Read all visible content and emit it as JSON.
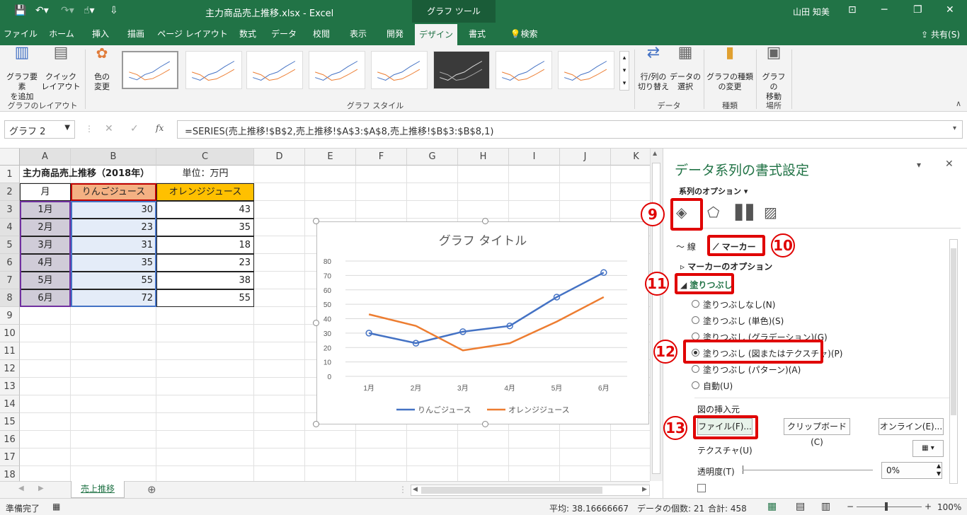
{
  "titlebar": {
    "title": "主力商品売上推移.xlsx  -  Excel",
    "tools_tab": "グラフ ツール",
    "user": "山田 知美"
  },
  "tabs": [
    {
      "label": "ファイル"
    },
    {
      "label": "ホーム"
    },
    {
      "label": "挿入"
    },
    {
      "label": "描画"
    },
    {
      "label": "ページ レイアウト"
    },
    {
      "label": "数式"
    },
    {
      "label": "データ"
    },
    {
      "label": "校閲"
    },
    {
      "label": "表示"
    },
    {
      "label": "開発"
    },
    {
      "label": "デザイン"
    },
    {
      "label": "書式"
    },
    {
      "label": "検索"
    }
  ],
  "share_label": "共有(S)",
  "ribbon": {
    "add_element": "グラフ要素\nを追加",
    "quick_layout": "クイック\nレイアウト",
    "change_color": "色の\n変更",
    "group_layout": "グラフのレイアウト",
    "group_style": "グラフ スタイル",
    "switch_rowcol": "行/列の\n切り替え",
    "select_data": "データの\n選択",
    "group_data": "データ",
    "change_type": "グラフの種類\nの変更",
    "group_type": "種類",
    "move_chart": "グラフの\n移動",
    "group_location": "場所"
  },
  "formula_bar": {
    "name_box": "グラフ 2",
    "formula": "=SERIES(売上推移!$B$2,売上推移!$A$3:$A$8,売上推移!$B$3:$B$8,1)",
    "fx": "fx"
  },
  "columns": [
    "A",
    "B",
    "C",
    "D",
    "E",
    "F",
    "G",
    "H",
    "I",
    "J",
    "K"
  ],
  "rows": [
    "1",
    "2",
    "3",
    "4",
    "5",
    "6",
    "7",
    "8",
    "9",
    "10",
    "11",
    "12",
    "13",
    "14",
    "15",
    "16",
    "17",
    "18"
  ],
  "sheet": {
    "title": "主力商品売上推移（2018年）",
    "unit": "単位：万円",
    "headers": [
      "月",
      "りんごジュース",
      "オレンジジュース"
    ],
    "data": [
      [
        "1月",
        "30",
        "43"
      ],
      [
        "2月",
        "23",
        "35"
      ],
      [
        "3月",
        "31",
        "18"
      ],
      [
        "4月",
        "35",
        "23"
      ],
      [
        "5月",
        "55",
        "38"
      ],
      [
        "6月",
        "72",
        "55"
      ]
    ]
  },
  "chart_data": {
    "type": "line",
    "title": "グラフ タイトル",
    "categories": [
      "1月",
      "2月",
      "3月",
      "4月",
      "5月",
      "6月"
    ],
    "yticks": [
      "0",
      "10",
      "20",
      "30",
      "40",
      "50",
      "60",
      "70",
      "80"
    ],
    "ylim": [
      0,
      80
    ],
    "series": [
      {
        "name": "りんごジュース",
        "values": [
          30,
          23,
          31,
          35,
          55,
          72
        ],
        "color": "#4472c4"
      },
      {
        "name": "オレンジジュース",
        "values": [
          43,
          35,
          18,
          23,
          38,
          55
        ],
        "color": "#ed7d31"
      }
    ],
    "legend": "bottom"
  },
  "sheet_tab": "売上推移",
  "pane": {
    "title": "データ系列の書式設定",
    "series_options": "系列のオプション",
    "tab_line": "線",
    "tab_marker": "マーカー",
    "marker_options": "マーカーのオプション",
    "fill": "塗りつぶし",
    "options": [
      {
        "label": "塗りつぶしなし(N)",
        "checked": false
      },
      {
        "label": "塗りつぶし (単色)(S)",
        "checked": false
      },
      {
        "label": "塗りつぶし (グラデーション)(G)",
        "checked": false
      },
      {
        "label": "塗りつぶし (図またはテクスチャ)(P)",
        "checked": true
      },
      {
        "label": "塗りつぶし (パターン)(A)",
        "checked": false
      },
      {
        "label": "自動(U)",
        "checked": false
      }
    ],
    "insert_from": "図の挿入元",
    "file_btn": "ファイル(F)...",
    "clipboard_btn": "クリップボード(C)",
    "online_btn": "オンライン(E)...",
    "texture": "テクスチャ(U)",
    "transparency": "透明度(T)",
    "transparency_value": "0%",
    "numbers": [
      "9",
      "10",
      "11",
      "12",
      "13"
    ]
  },
  "status": {
    "ready": "準備完了",
    "average": "平均: 38.16666667",
    "count": "データの個数: 21",
    "sum": "合計: 458",
    "zoom": "100%"
  }
}
